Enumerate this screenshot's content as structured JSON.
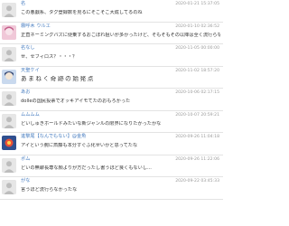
{
  "comments": [
    {
      "author": "名",
      "date": "2020-01-21 15:37:05",
      "text": "この悪戯系、タグ登録数を見るにそこそこ大成してるのね"
    },
    {
      "author": "霧呼木 ウルエ",
      "date": "2020-01-10 02:36:52",
      "text": "正直ネーミングバズに便乗するおこぼれ狙いが多かったけど、そもそもその以降は全く流行らなかったし、なんなら無かった。"
    },
    {
      "author": "名なし",
      "date": "2020-11-05 00:00:00",
      "text": "せ、セフィロス？・・・？"
    },
    {
      "author": "天聖ケイ",
      "date": "2020-11-02 18:57:20",
      "text": "あまねく奇跡の始発点"
    },
    {
      "author": "あお",
      "date": "2020-10-06 02:17:15",
      "text": "dolleの国民投票でオッキアイモてたのおもろかった"
    },
    {
      "author": "ムムムム",
      "date": "2020-10-07 20:59:21",
      "text": "どいしゅきホールドみたいな新ジャンルの限界になりたかったかな"
    },
    {
      "author": "進撃尾【なんでもない】@金魚",
      "date": "2020-09-26 11:04:18",
      "text": "アイという腕に斎藤も本分すぐふ化せいかと思ってたな"
    },
    {
      "author": "ポム",
      "date": "2020-09-26 11:22:06",
      "text": "どいの無聊長尊な顔よりが方だったし書うほど良くもないし..."
    },
    {
      "author": "がな",
      "date": "2020-09-22 03:45:33",
      "text": "言うほど流行らなかったな"
    }
  ]
}
